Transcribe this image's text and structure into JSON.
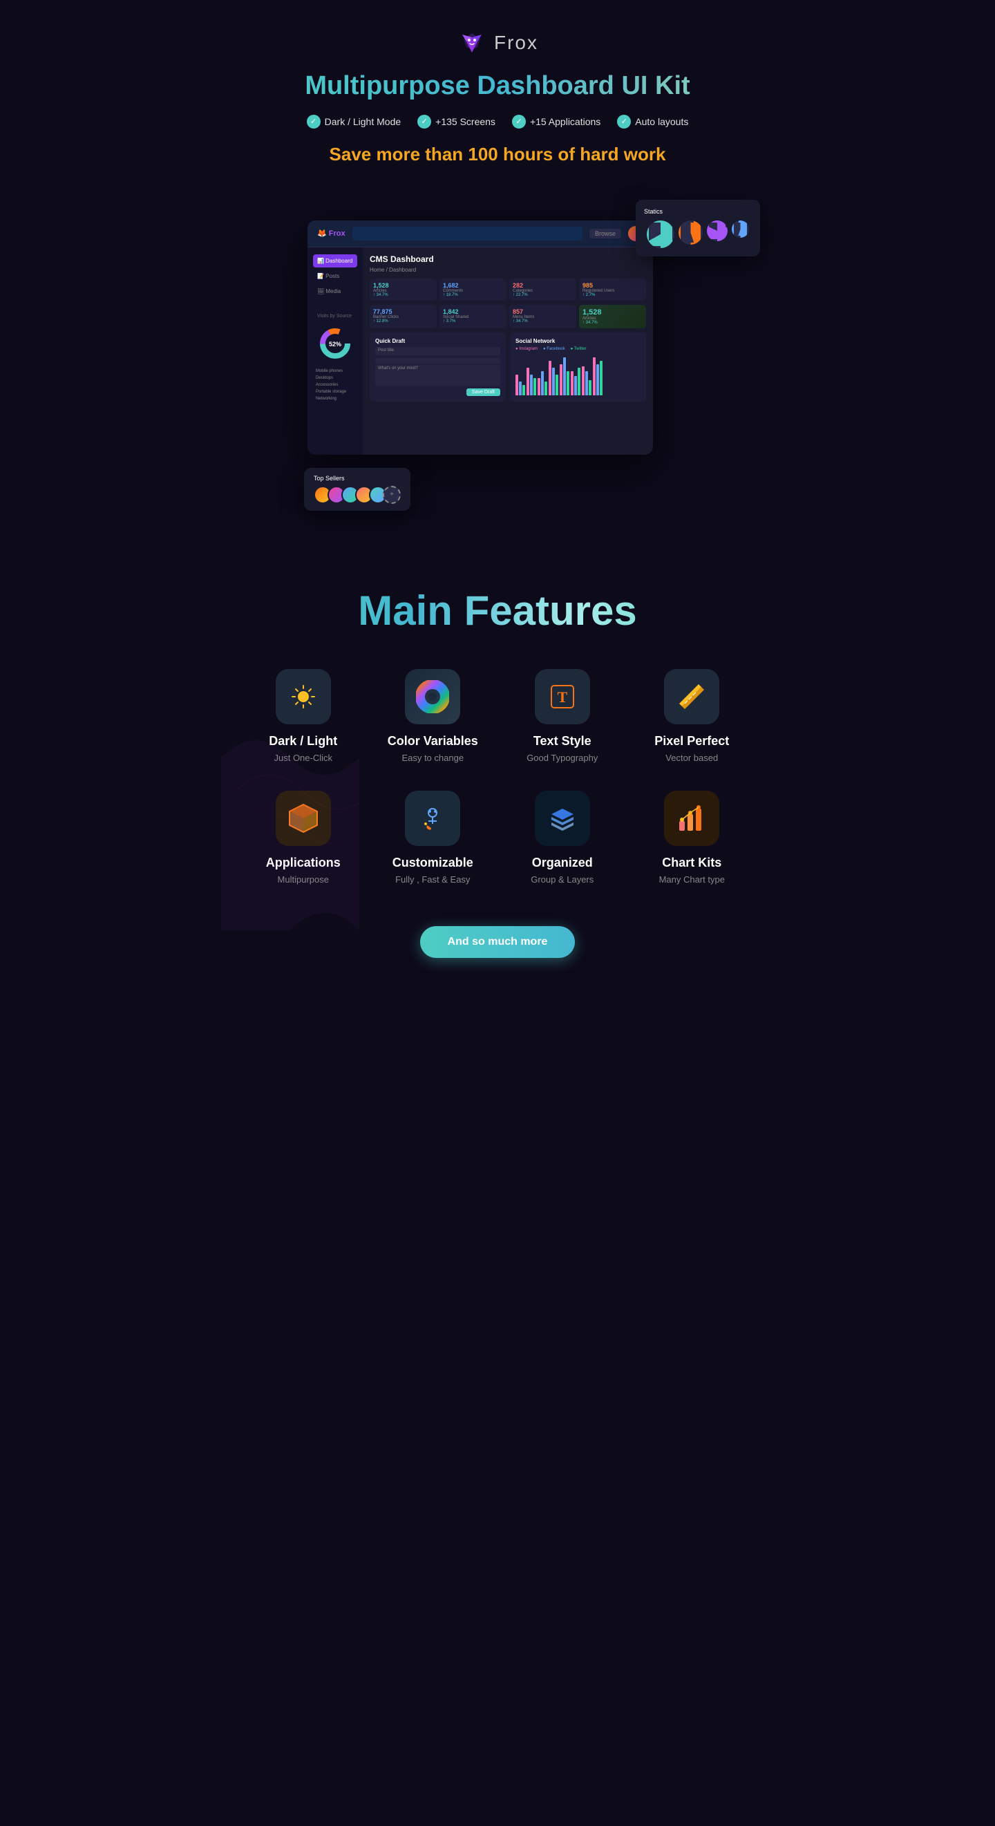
{
  "header": {
    "logo_text": "Frox",
    "main_title": "Multipurpose Dashboard UI Kit",
    "badges": [
      {
        "text": "Dark / Light Mode"
      },
      {
        "text": "+135 Screens"
      },
      {
        "text": "+15 Applications"
      },
      {
        "text": "Auto layouts"
      }
    ],
    "save_text": "Save more than 100 hours of hard work"
  },
  "dashboard_preview": {
    "title": "CMS Dashboard",
    "subtitle": "Home / Dashboard",
    "stats": [
      {
        "num": "1,528",
        "label": "Articles",
        "change": "↑ 34.7%"
      },
      {
        "num": "1,682",
        "label": "Comments",
        "change": "↑ 18.7%"
      },
      {
        "num": "282",
        "label": "Categories",
        "change": "↑ 22.7%"
      },
      {
        "num": "985",
        "label": "Registered Users",
        "change": "↑ 2.7%"
      }
    ],
    "stats2": [
      {
        "num": "77,875",
        "label": "Banner Clicks",
        "change": "↑ 12.8%"
      },
      {
        "num": "1,842",
        "label": "Social Shared",
        "change": "↑ 3.7%"
      },
      {
        "num": "857",
        "label": "Menu Items",
        "change": "↑ 34.7%"
      }
    ],
    "sidebar": [
      "Dashboard",
      "Posts",
      "Media"
    ],
    "float_card": {
      "title": "Statics"
    },
    "top_sellers_label": "Top Sellers"
  },
  "features": {
    "section_title": "Main Features",
    "items": [
      {
        "name": "Dark / Light",
        "sub": "Just One-Click",
        "icon": "☀️",
        "box_class": "icon-dark"
      },
      {
        "name": "Color Variables",
        "sub": "Easy to change",
        "icon": "🎨",
        "box_class": "icon-color"
      },
      {
        "name": "Text Style",
        "sub": "Good Typography",
        "icon": "T",
        "box_class": "icon-text"
      },
      {
        "name": "Pixel Perfect",
        "sub": "Vector based",
        "icon": "📐",
        "box_class": "icon-pixel"
      },
      {
        "name": "Applications",
        "sub": "Multipurpose",
        "icon": "📦",
        "box_class": "icon-app"
      },
      {
        "name": "Customizable",
        "sub": "Fully , Fast &  Easy",
        "icon": "🎯",
        "box_class": "icon-custom"
      },
      {
        "name": "Organized",
        "sub": "Group & Layers",
        "icon": "📚",
        "box_class": "icon-org"
      },
      {
        "name": "Chart Kits",
        "sub": "Many Chart type",
        "icon": "📊",
        "box_class": "icon-chart"
      }
    ],
    "more_button": "And so much more"
  }
}
